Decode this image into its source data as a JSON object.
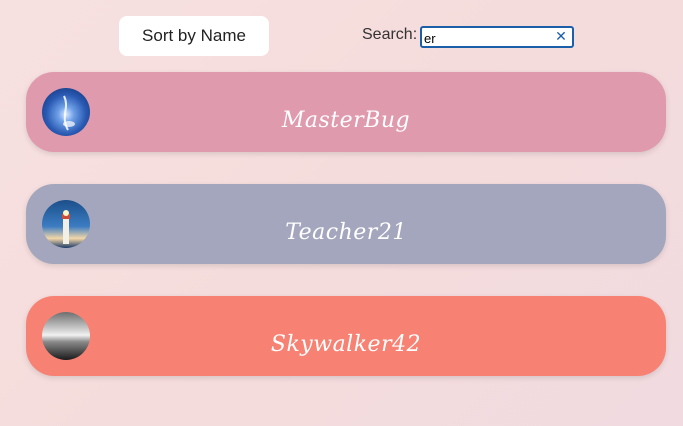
{
  "toolbar": {
    "sort_label": "Sort by Name"
  },
  "search": {
    "label": "Search:",
    "value": "er",
    "clear_icon": "close-icon"
  },
  "users": [
    {
      "name": "MasterBug",
      "color": "#e09aad",
      "avatar": "blue-light-avatar"
    },
    {
      "name": "Teacher21",
      "color": "#a3a6bd",
      "avatar": "lighthouse-avatar"
    },
    {
      "name": "Skywalker42",
      "color": "#f78274",
      "avatar": "grayscale-avatar"
    }
  ]
}
